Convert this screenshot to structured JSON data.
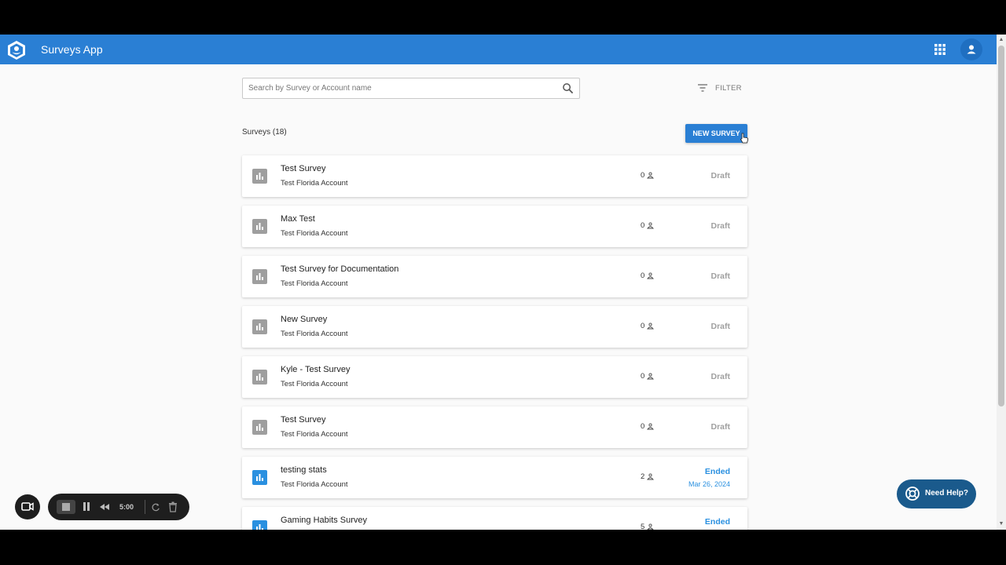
{
  "header": {
    "app_title": "Surveys App"
  },
  "search": {
    "placeholder": "Search by Survey or Account name",
    "value": ""
  },
  "filter": {
    "label": "FILTER"
  },
  "surveys_count": "Surveys (18)",
  "new_survey_label": "NEW SURVEY",
  "surveys": [
    {
      "title": "Test Survey",
      "account": "Test Florida Account",
      "responses": "0",
      "status": "Draft",
      "date": ""
    },
    {
      "title": "Max Test",
      "account": "Test Florida Account",
      "responses": "0",
      "status": "Draft",
      "date": ""
    },
    {
      "title": "Test Survey for Documentation",
      "account": "Test Florida Account",
      "responses": "0",
      "status": "Draft",
      "date": ""
    },
    {
      "title": "New Survey",
      "account": "Test Florida Account",
      "responses": "0",
      "status": "Draft",
      "date": ""
    },
    {
      "title": "Kyle - Test Survey",
      "account": "Test Florida Account",
      "responses": "0",
      "status": "Draft",
      "date": ""
    },
    {
      "title": "Test Survey",
      "account": "Test Florida Account",
      "responses": "0",
      "status": "Draft",
      "date": ""
    },
    {
      "title": "testing stats",
      "account": "Test Florida Account",
      "responses": "2",
      "status": "Ended",
      "date": "Mar 26, 2024"
    },
    {
      "title": "Gaming Habits Survey",
      "account": "",
      "responses": "5",
      "status": "Ended",
      "date": ""
    }
  ],
  "help": {
    "label": "Need Help?"
  },
  "recorder": {
    "time": "5:00"
  },
  "colors": {
    "primary": "#2a7fd4",
    "ended": "#2a90e0",
    "draft": "#a0a0a0",
    "help": "#1a5a8c"
  }
}
